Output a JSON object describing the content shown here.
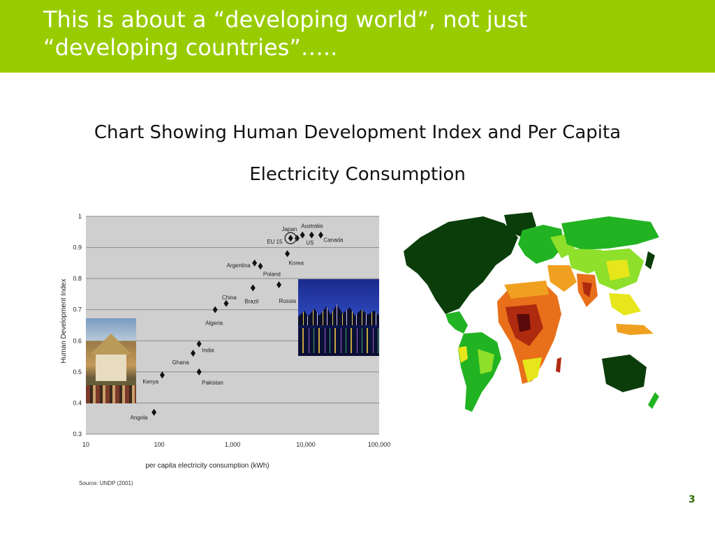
{
  "header": {
    "title_line1": "This is about a “developing world”, not just",
    "title_line2": "“developing countries”…..",
    "bar_color": "#99cc00"
  },
  "slide": {
    "heading_line1": "Chart Showing Human Development Index and Per Capita",
    "heading_line2": "Electricity Consumption",
    "page_number": "3"
  },
  "chart_data": {
    "type": "scatter",
    "xlabel": "per capita electricity consumption (kWh)",
    "ylabel": "Human Development Index",
    "xscale": "log",
    "xlim": [
      10,
      100000
    ],
    "ylim": [
      0.3,
      1
    ],
    "x_ticks": [
      "10",
      "100",
      "1,000",
      "10,000",
      "100,000"
    ],
    "y_ticks": [
      "0.3",
      "0.4",
      "0.5",
      "0.6",
      "0.7",
      "0.8",
      "0.9",
      "1"
    ],
    "grid": true,
    "source": "Source: UNDP (2001)",
    "points": [
      {
        "label": "Angola",
        "x": 85,
        "y": 0.37
      },
      {
        "label": "Kenya",
        "x": 110,
        "y": 0.49
      },
      {
        "label": "Pakistan",
        "x": 350,
        "y": 0.5
      },
      {
        "label": "Ghana",
        "x": 290,
        "y": 0.56
      },
      {
        "label": "India",
        "x": 350,
        "y": 0.59
      },
      {
        "label": "Algeria",
        "x": 580,
        "y": 0.7
      },
      {
        "label": "China",
        "x": 820,
        "y": 0.72
      },
      {
        "label": "Brazil",
        "x": 1900,
        "y": 0.77
      },
      {
        "label": "Russia",
        "x": 4300,
        "y": 0.78
      },
      {
        "label": "Argentina",
        "x": 2000,
        "y": 0.85
      },
      {
        "label": "Poland",
        "x": 2400,
        "y": 0.84
      },
      {
        "label": "Korea",
        "x": 5600,
        "y": 0.88
      },
      {
        "label": "EU 15",
        "x": 6200,
        "y": 0.93
      },
      {
        "label": "Japan",
        "x": 7600,
        "y": 0.93
      },
      {
        "label": "US",
        "x": 12000,
        "y": 0.94
      },
      {
        "label": "Australia",
        "x": 9000,
        "y": 0.94
      },
      {
        "label": "Canada",
        "x": 16000,
        "y": 0.94
      }
    ]
  },
  "map": {
    "legend_colors": [
      "#0a3d0a",
      "#22b322",
      "#8ee02a",
      "#e6e61a",
      "#f0a020",
      "#e8701a",
      "#b02a10",
      "#5a0a0a"
    ]
  }
}
